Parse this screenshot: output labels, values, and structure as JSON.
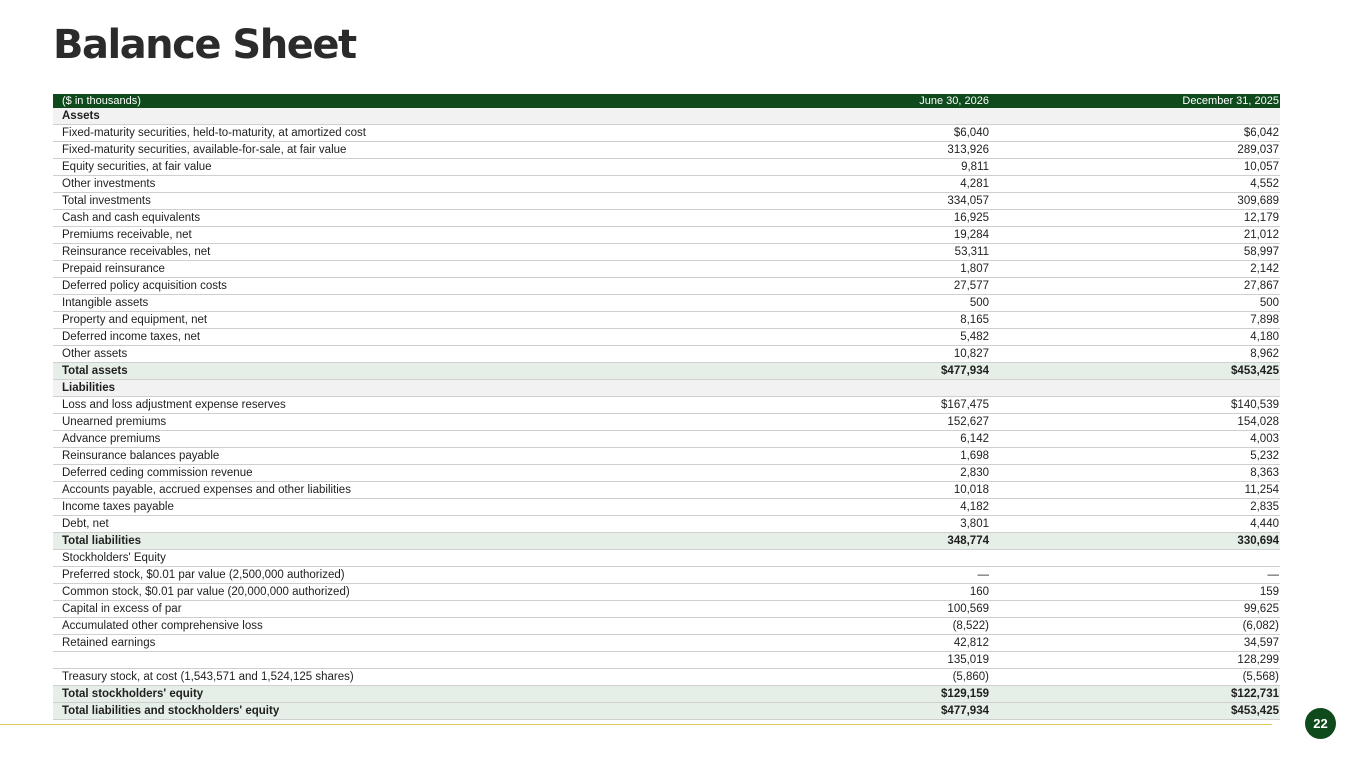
{
  "title": "Balance Sheet",
  "header": {
    "label": "($ in thousands)",
    "col_a": "June 30, 2026",
    "col_b": "December 31, 2025"
  },
  "rows": [
    {
      "label": "Assets",
      "a": "",
      "b": "",
      "kind": "section"
    },
    {
      "label": "Fixed-maturity securities, held-to-maturity, at amortized cost",
      "a": "$6,040",
      "b": "$6,042",
      "kind": "row"
    },
    {
      "label": "Fixed-maturity securities, available-for-sale, at fair value",
      "a": "313,926",
      "b": "289,037",
      "kind": "row"
    },
    {
      "label": "Equity securities, at fair value",
      "a": "9,811",
      "b": "10,057",
      "kind": "row"
    },
    {
      "label": "Other investments",
      "a": "4,281",
      "b": "4,552",
      "kind": "row"
    },
    {
      "label": "Total investments",
      "a": "334,057",
      "b": "309,689",
      "kind": "row"
    },
    {
      "label": "Cash and cash equivalents",
      "a": "16,925",
      "b": "12,179",
      "kind": "row"
    },
    {
      "label": "Premiums receivable, net",
      "a": "19,284",
      "b": "21,012",
      "kind": "row"
    },
    {
      "label": "Reinsurance receivables, net",
      "a": "53,311",
      "b": "58,997",
      "kind": "row"
    },
    {
      "label": "Prepaid reinsurance",
      "a": "1,807",
      "b": "2,142",
      "kind": "row"
    },
    {
      "label": "Deferred policy acquisition costs",
      "a": "27,577",
      "b": "27,867",
      "kind": "row"
    },
    {
      "label": "Intangible assets",
      "a": "500",
      "b": "500",
      "kind": "row"
    },
    {
      "label": "Property and equipment, net",
      "a": "8,165",
      "b": "7,898",
      "kind": "row"
    },
    {
      "label": "Deferred income taxes, net",
      "a": "5,482",
      "b": "4,180",
      "kind": "row"
    },
    {
      "label": "Other assets",
      "a": "10,827",
      "b": "8,962",
      "kind": "row"
    },
    {
      "label": "Total assets",
      "a": "$477,934",
      "b": "$453,425",
      "kind": "total"
    },
    {
      "label": "Liabilities",
      "a": "",
      "b": "",
      "kind": "section"
    },
    {
      "label": "Loss and loss adjustment expense reserves",
      "a": "$167,475",
      "b": "$140,539",
      "kind": "row"
    },
    {
      "label": "Unearned premiums",
      "a": "152,627",
      "b": "154,028",
      "kind": "row"
    },
    {
      "label": "Advance premiums",
      "a": "6,142",
      "b": "4,003",
      "kind": "row"
    },
    {
      "label": "Reinsurance balances payable",
      "a": "1,698",
      "b": "5,232",
      "kind": "row"
    },
    {
      "label": "Deferred ceding commission revenue",
      "a": "2,830",
      "b": "8,363",
      "kind": "row"
    },
    {
      "label": "Accounts payable, accrued expenses and other liabilities",
      "a": "10,018",
      "b": "11,254",
      "kind": "row"
    },
    {
      "label": "Income taxes payable",
      "a": "4,182",
      "b": "2,835",
      "kind": "row"
    },
    {
      "label": "Debt, net",
      "a": "3,801",
      "b": "4,440",
      "kind": "row"
    },
    {
      "label": "Total liabilities",
      "a": "348,774",
      "b": "330,694",
      "kind": "total"
    },
    {
      "label": "Stockholders' Equity",
      "a": "",
      "b": "",
      "kind": "section-plain"
    },
    {
      "label": "Preferred stock, $0.01 par value (2,500,000 authorized)",
      "a": "—",
      "b": "—",
      "kind": "row"
    },
    {
      "label": "Common stock, $0.01 par value (20,000,000 authorized)",
      "a": "160",
      "b": "159",
      "kind": "row"
    },
    {
      "label": "Capital in excess of par",
      "a": "100,569",
      "b": "99,625",
      "kind": "row"
    },
    {
      "label": "Accumulated other comprehensive loss",
      "a": "(8,522)",
      "b": "(6,082)",
      "kind": "row"
    },
    {
      "label": "Retained earnings",
      "a": "42,812",
      "b": "34,597",
      "kind": "row"
    },
    {
      "label": "",
      "a": "135,019",
      "b": "128,299",
      "kind": "row"
    },
    {
      "label": "Treasury stock, at cost (1,543,571 and 1,524,125 shares)",
      "a": "(5,860)",
      "b": "(5,568)",
      "kind": "row"
    },
    {
      "label": "Total stockholders' equity",
      "a": "$129,159",
      "b": "$122,731",
      "kind": "total"
    },
    {
      "label": "Total liabilities and stockholders' equity",
      "a": "$477,934",
      "b": "$453,425",
      "kind": "total"
    }
  ],
  "page_number": "22",
  "colors": {
    "header_green": "#0f4a1c",
    "total_row_bg": "#e6efe7",
    "footer_line": "#e0c75a"
  }
}
